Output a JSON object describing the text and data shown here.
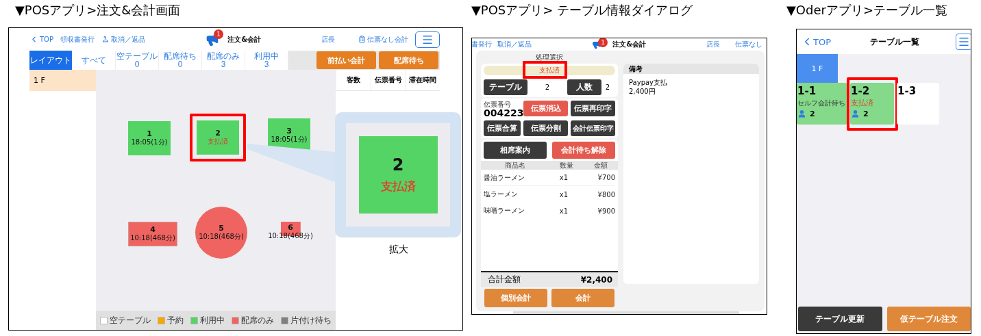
{
  "pos_order_screen": {
    "caption": "▼POSアプリ>注文&会計画面",
    "header": {
      "back": "TOP",
      "links": [
        "領収書発行",
        "取消／返品"
      ],
      "badge": "1",
      "title": "注文&会計",
      "user": "店長",
      "no_slip": "伝票なし会計"
    },
    "filter_tabs": [
      {
        "label": "レイアウト",
        "selected": true
      },
      {
        "label": "すべて",
        "selected": false
      },
      {
        "label": "空テーブル",
        "count": "0",
        "selected": false
      },
      {
        "label": "配席待ち",
        "count": "0",
        "selected": false
      },
      {
        "label": "配席のみ",
        "count": "3",
        "selected": false
      },
      {
        "label": "利用中",
        "count": "3",
        "selected": false
      }
    ],
    "action_buttons": [
      "前払い会計",
      "配席待ち"
    ],
    "floors": [
      {
        "label": "1 F",
        "selected": true
      }
    ],
    "columns": [
      "客数",
      "伝票番号",
      "滞在時間"
    ],
    "tables": [
      {
        "number": "1",
        "info": "18:05(1分)",
        "paid": false,
        "kind": "square",
        "color": "#55d466"
      },
      {
        "number": "2",
        "info": "支払済",
        "paid": true,
        "kind": "square",
        "color": "#55d466",
        "highlighted": true
      },
      {
        "number": "3",
        "info": "18:05(1分)",
        "paid": false,
        "kind": "square",
        "color": "#55d466"
      },
      {
        "number": "4",
        "info": "10:18(468分)",
        "paid": false,
        "kind": "rect",
        "color": "#ef6461"
      },
      {
        "number": "5",
        "info": "10:18(468分)",
        "paid": false,
        "kind": "round",
        "color": "#ef6461"
      },
      {
        "number": "6",
        "info": "10:18(468分)",
        "paid": false,
        "kind": "small",
        "color": "#ef6461"
      }
    ],
    "magnified": {
      "number": "2",
      "info": "支払済",
      "caption": "拡大"
    },
    "legend": [
      {
        "label": "空テーブル",
        "color": "#ffffff"
      },
      {
        "label": "予約",
        "color": "#f5a800"
      },
      {
        "label": "利用中",
        "color": "#55d466"
      },
      {
        "label": "配席のみ",
        "color": "#ef6461"
      },
      {
        "label": "片付け待ち",
        "color": "#7f7f7f"
      }
    ]
  },
  "pos_table_dialog": {
    "caption": "▼POSアプリ> テーブル情報ダイアログ",
    "background_header": {
      "links": [
        "書発行",
        "取消／返品"
      ],
      "badge": "1",
      "title": "注文&会計",
      "user": "店長",
      "no_slip": "伝票なし"
    },
    "title": "処理選択",
    "status": {
      "label": "支払済",
      "highlighted": true
    },
    "table_label": "テーブル",
    "table_value": "2",
    "people_label": "人数",
    "people_value": "2",
    "slip_label": "伝票番号",
    "slip_number": "004223",
    "slip_buttons": [
      {
        "label": "伝票消込",
        "kind": "danger"
      },
      {
        "label": "伝票再印字",
        "kind": "dark"
      },
      {
        "label": "伝票合算",
        "kind": "dark"
      },
      {
        "label": "伝票分割",
        "kind": "dark"
      },
      {
        "label": "会計伝票印字",
        "kind": "dark"
      }
    ],
    "guide_buttons": [
      {
        "label": "相席案内",
        "kind": "dark"
      },
      {
        "label": "会計待ち解除",
        "kind": "danger"
      }
    ],
    "item_columns": [
      "商品名",
      "数量",
      "金額"
    ],
    "items": [
      {
        "name": "醤油ラーメン",
        "qty": "x1",
        "price": "¥700"
      },
      {
        "name": "塩ラーメン",
        "qty": "x1",
        "price": "¥800"
      },
      {
        "name": "味噌ラーメン",
        "qty": "x1",
        "price": "¥900"
      }
    ],
    "total_label": "合計金額",
    "total": "¥2,400",
    "footer_buttons": [
      "個別会計",
      "会計"
    ],
    "notes_title": "備考",
    "notes": [
      "Paypay支払",
      "2,400円"
    ]
  },
  "order_app_table_list": {
    "caption": "▼Oderアプリ>テーブル一覧",
    "back": "TOP",
    "title": "テーブル一覧",
    "floors": [
      {
        "label": "1 F",
        "selected": true
      }
    ],
    "tables": [
      {
        "name": "1-1",
        "occupied": true,
        "status": "セルフ会計待ち",
        "paid": false,
        "guests": "2"
      },
      {
        "name": "1-2",
        "occupied": true,
        "status": "支払済",
        "paid": true,
        "guests": "2",
        "highlighted": true
      },
      {
        "name": "1-3",
        "occupied": false
      }
    ],
    "buttons": [
      {
        "label": "テーブル更新",
        "kind": "dark"
      },
      {
        "label": "仮テーブル注文",
        "kind": "accent"
      }
    ]
  }
}
